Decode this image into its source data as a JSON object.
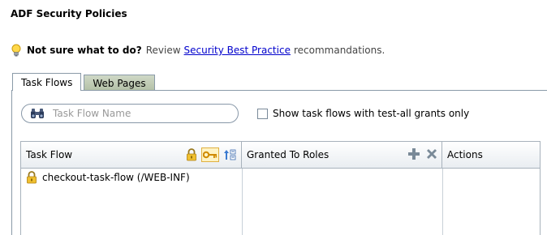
{
  "page": {
    "title": "ADF Security Policies"
  },
  "hint": {
    "icon": "lightbulb-icon",
    "question": "Not sure what to do?",
    "prefix": "Review",
    "link": "Security Best Practice",
    "suffix": "recommandations."
  },
  "tabs": [
    {
      "label": "Task Flows",
      "active": true
    },
    {
      "label": "Web Pages",
      "active": false
    }
  ],
  "search": {
    "placeholder": "Task Flow Name",
    "value": "",
    "icon": "binoculars-icon"
  },
  "filter": {
    "label": "Show task flows with test-all grants only",
    "checked": false
  },
  "table": {
    "columns": [
      "Task Flow",
      "Granted To Roles",
      "Actions"
    ],
    "task_flow_icons": [
      "lock-icon",
      "key-icon",
      "sort-icon"
    ],
    "role_icons": [
      "add-icon",
      "delete-icon"
    ],
    "rows": [
      {
        "name": "checkout-task-flow (/WEB-INF)",
        "icon": "lock-icon"
      }
    ]
  },
  "colors": {
    "link": "#0000cc",
    "inactive_tab": "#c3cdb8",
    "border": "#8a9aa8"
  }
}
